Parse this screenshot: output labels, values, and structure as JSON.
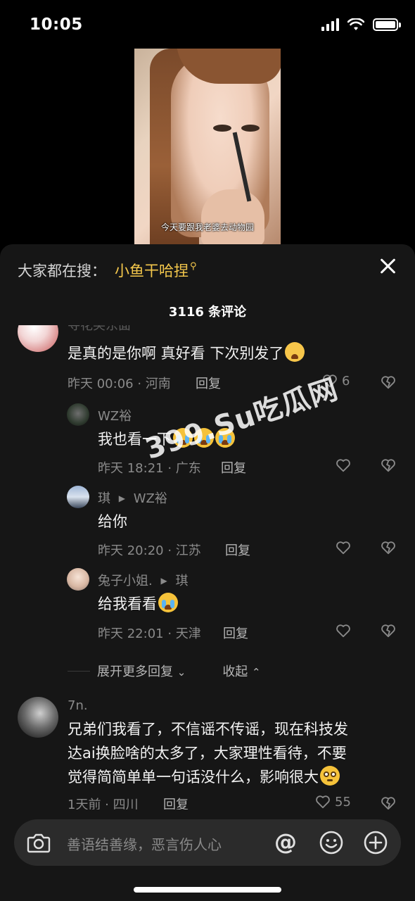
{
  "status_bar": {
    "time": "10:05"
  },
  "video": {
    "subtitle": "今天要跟我老婆去动物园"
  },
  "panel": {
    "search_prefix": "大家都在搜：",
    "search_term": "小鱼干哈捏",
    "comment_count": "3116 条评论"
  },
  "comments": [
    {
      "name": "寻花笑东面",
      "text": "是真的是你啊  真好看 下次别发了",
      "emoji": "hug-face-emoji",
      "meta": "昨天 00:06 · 河南",
      "reply_label": "回复",
      "likes": "6"
    },
    {
      "name": "WZ裕",
      "text": "我也看一下",
      "emoji": "crying-face-emoji",
      "meta": "昨天 18:21 · 广东",
      "reply_label": "回复"
    },
    {
      "name": "琪",
      "reply_to": "WZ裕",
      "text": "给你",
      "meta": "昨天 20:20 · 江苏",
      "reply_label": "回复"
    },
    {
      "name": "兔子小姐.",
      "reply_to": "琪",
      "text": "给我看看",
      "emoji": "crying-face-emoji",
      "meta": "昨天 22:01 · 天津",
      "reply_label": "回复"
    },
    {
      "name": "7n.",
      "text_lines": [
        "兄弟们我看了，不信谣不传谣，现在科技发",
        "达ai换脸啥的太多了，大家理性看待，不要",
        "觉得简简单单一句话没什么，影响很大"
      ],
      "emoji": "flushed-face-emoji",
      "meta": "1天前 · 四川",
      "reply_label": "回复",
      "likes": "55"
    }
  ],
  "expand": {
    "more_label": "展开更多回复",
    "collapse_label": "收起"
  },
  "input": {
    "placeholder": "善语结善缘，恶言伤人心",
    "at_symbol": "@"
  },
  "watermark": "399.Su吃瓜网",
  "colors": {
    "accent": "#f5c84c",
    "panel_bg": "#161616",
    "input_bg": "#2b2b2b"
  }
}
